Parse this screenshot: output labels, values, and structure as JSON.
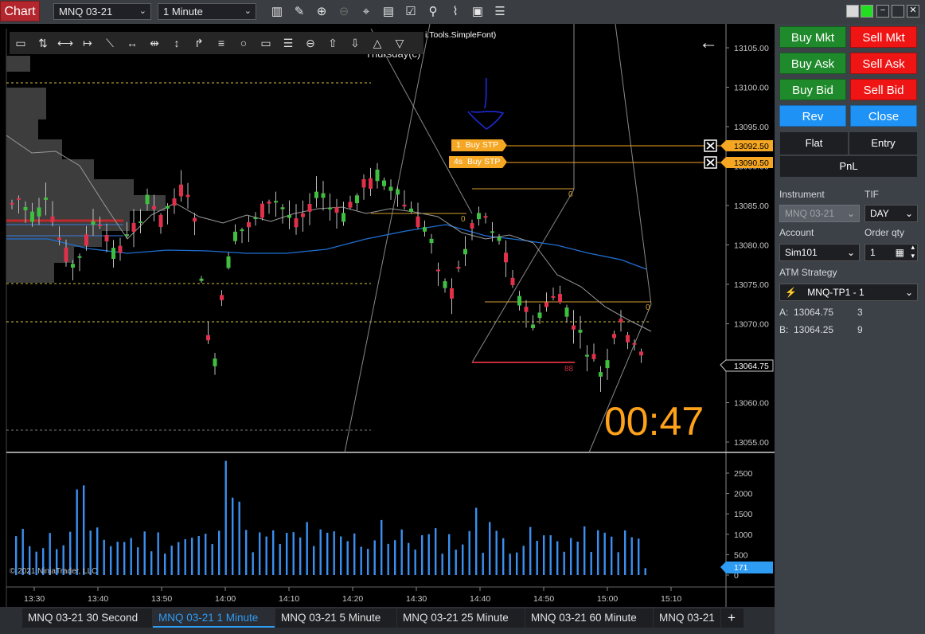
{
  "toolbar": {
    "chart_label": "Chart",
    "instrument": "MNQ 03-21",
    "interval": "1 Minute"
  },
  "chart": {
    "indicator_text": "i.Tools.SimpleFont)",
    "day_label": "Thursday(c)",
    "copyright": "© 2021 NinjaTrader, LLC",
    "timer": "00:47",
    "back_arrow": "←",
    "price_axis": [
      "13105.00",
      "13100.00",
      "13095.00",
      "13090.00",
      "13085.00",
      "13080.00",
      "13075.00",
      "13070.00",
      "13060.00",
      "13055.00"
    ],
    "current_price": "13064.75",
    "volume_axis": [
      "2500",
      "2000",
      "1500",
      "1000",
      "500",
      "0"
    ],
    "current_volume": "171",
    "time_axis": [
      "13:30",
      "13:40",
      "13:50",
      "14:00",
      "14:10",
      "14:20",
      "14:30",
      "14:40",
      "14:50",
      "15:00",
      "15:10"
    ],
    "orders": [
      {
        "qty": "1",
        "label": "Buy STP",
        "price": "13092.50"
      },
      {
        "qty": "4s",
        "label": "Buy STP",
        "price": "13090.50"
      }
    ],
    "ruler_labels": [
      "0",
      "0",
      "0",
      "88"
    ]
  },
  "order_panel": {
    "buy_mkt": "Buy Mkt",
    "sell_mkt": "Sell Mkt",
    "buy_ask": "Buy Ask",
    "sell_ask": "Sell Ask",
    "buy_bid": "Buy Bid",
    "sell_bid": "Sell Bid",
    "rev": "Rev",
    "close": "Close",
    "flat": "Flat",
    "entry": "Entry",
    "pnl": "PnL",
    "instrument_label": "Instrument",
    "instrument_value": "MNQ 03-21",
    "tif_label": "TIF",
    "tif_value": "DAY",
    "account_label": "Account",
    "account_value": "Sim101",
    "order_qty_label": "Order qty",
    "order_qty_value": "1",
    "atm_label": "ATM Strategy",
    "atm_value": "MNQ-TP1 - 1",
    "ask_label": "A:",
    "ask_price": "13064.75",
    "ask_size": "3",
    "bid_label": "B:",
    "bid_price": "13064.25",
    "bid_size": "9"
  },
  "tabs": [
    "MNQ 03-21 30 Second",
    "MNQ 03-21 1 Minute",
    "MNQ 03-21 5 Minute",
    "MNQ 03-21 25 Minute",
    "MNQ 03-21 60 Minute",
    "MNQ 03-21"
  ],
  "add_tab": "+",
  "colors": {
    "up": "#3fbf3f",
    "down": "#e0304a",
    "accent": "#2f9cf4",
    "order": "#f5a623"
  }
}
